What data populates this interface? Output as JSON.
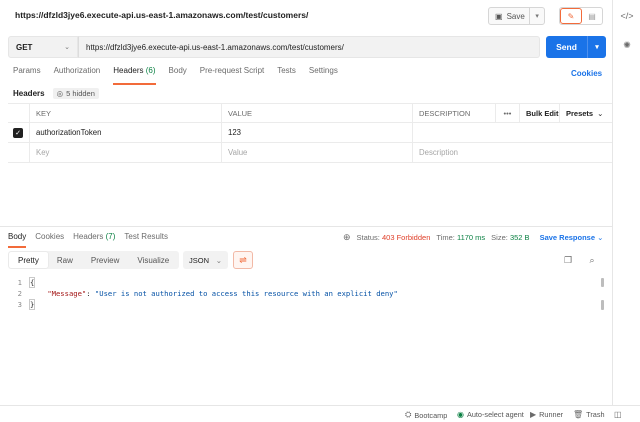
{
  "request": {
    "title": "https://dfzld3jye6.execute-api.us-east-1.amazonaws.com/test/customers/",
    "save_label": "Save",
    "method": "GET",
    "url": "https://dfzld3jye6.execute-api.us-east-1.amazonaws.com/test/customers/",
    "send_label": "Send"
  },
  "request_tabs": [
    {
      "label": "Params"
    },
    {
      "label": "Authorization"
    },
    {
      "label": "Headers",
      "count": "(6)"
    },
    {
      "label": "Body"
    },
    {
      "label": "Pre-request Script"
    },
    {
      "label": "Tests"
    },
    {
      "label": "Settings"
    }
  ],
  "cookies_label": "Cookies",
  "headers_section": {
    "label": "Headers",
    "hidden_label": "5 hidden",
    "columns": {
      "key": "KEY",
      "value": "VALUE",
      "description": "DESCRIPTION",
      "bulk_edit": "Bulk Edit",
      "presets": "Presets"
    },
    "rows": [
      {
        "key": "authorizationToken",
        "value": "123",
        "description": ""
      }
    ],
    "placeholder": {
      "key": "Key",
      "value": "Value",
      "description": "Description"
    }
  },
  "response_tabs": [
    {
      "label": "Body"
    },
    {
      "label": "Cookies"
    },
    {
      "label": "Headers",
      "count": "(7)"
    },
    {
      "label": "Test Results"
    }
  ],
  "response_status": {
    "status_label": "Status:",
    "status_value": "403 Forbidden",
    "time_label": "Time:",
    "time_value": "1170 ms",
    "size_label": "Size:",
    "size_value": "352 B",
    "save_response": "Save Response"
  },
  "view_modes": [
    "Pretty",
    "Raw",
    "Preview",
    "Visualize"
  ],
  "format": "JSON",
  "response_body": {
    "lines": [
      "1",
      "2",
      "3"
    ],
    "open_brace": "{",
    "key": "\"Message\"",
    "colon": ": ",
    "value": "\"User is not authorized to access this resource with an explicit deny\"",
    "close_brace": "}"
  },
  "footer": {
    "bootcamp": "Bootcamp",
    "auto_select": "Auto-select agent",
    "runner": "Runner",
    "trash": "Trash"
  },
  "colors": {
    "accent": "#f26b3a",
    "primary": "#1a73e8",
    "error": "#e0402a",
    "success": "#0b8043"
  }
}
